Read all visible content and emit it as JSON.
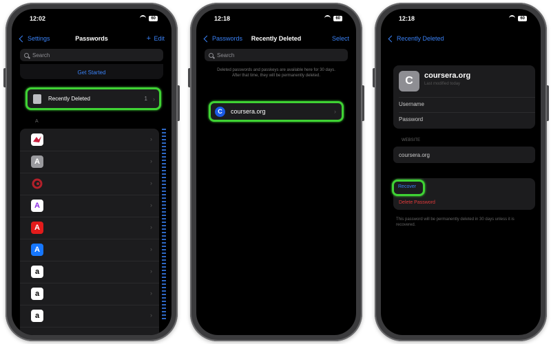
{
  "phone1": {
    "time": "12:02",
    "battery": "60",
    "nav": {
      "back": "Settings",
      "title": "Passwords",
      "plus": "+",
      "right": "Edit"
    },
    "search_placeholder": "Search",
    "security_link": "Get Started",
    "recently_deleted": {
      "label": "Recently Deleted",
      "count": "1"
    },
    "section_letter": "A",
    "app_rows": [
      {
        "icon": "app-icon-red-bird",
        "letter": ""
      },
      {
        "icon": "app-icon-gray-a",
        "letter": "A"
      },
      {
        "icon": "app-icon-red-swirl",
        "letter": ""
      },
      {
        "icon": "app-icon-purple-a",
        "letter": "A"
      },
      {
        "icon": "app-icon-adobe",
        "letter": "A"
      },
      {
        "icon": "app-icon-blue-a",
        "letter": "A"
      },
      {
        "icon": "amazon-icon",
        "letter": "a"
      },
      {
        "icon": "amazon-icon",
        "letter": "a"
      },
      {
        "icon": "amazon-icon",
        "letter": "a"
      }
    ]
  },
  "phone2": {
    "time": "12:18",
    "battery": "60",
    "nav": {
      "back": "Passwords",
      "title": "Recently Deleted",
      "right": "Select"
    },
    "search_placeholder": "Search",
    "note": "Deleted passwords and passkeys are available here for 30 days. After that time, they will be permanently deleted.",
    "item": {
      "icon_letter": "C",
      "label": "coursera.org"
    }
  },
  "phone3": {
    "time": "12:18",
    "battery": "60",
    "nav": {
      "back": "Recently Deleted"
    },
    "site": {
      "icon_letter": "C",
      "title": "coursera.org",
      "subtitle": "Last modified today"
    },
    "username_label": "Username",
    "password_label": "Password",
    "website_label": "WEBSITE",
    "website": "coursera.org",
    "recover": "Recover",
    "delete": "Delete Password",
    "note": "This password will be permanently deleted in 30 days unless it is recovered."
  },
  "colors": {
    "accent": "#3a82f7",
    "highlight": "#3fd234",
    "danger": "#e03a3a",
    "background": "#000000"
  }
}
